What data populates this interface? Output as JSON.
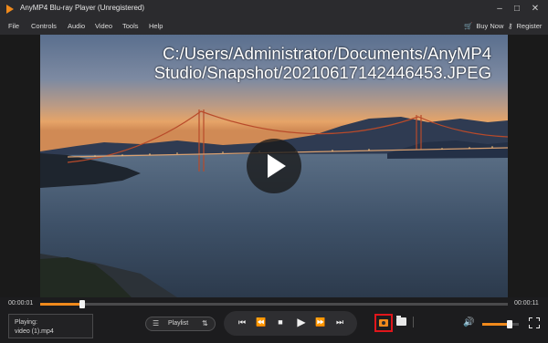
{
  "titlebar": {
    "title": "AnyMP4 Blu-ray Player (Unregistered)",
    "icons": [
      "app-logo-icon",
      "minimize-icon",
      "maximize-icon",
      "close-icon"
    ]
  },
  "menu": {
    "items": [
      "File",
      "Controls",
      "Audio",
      "Video",
      "Tools",
      "Help"
    ],
    "buy_now": "Buy Now",
    "register": "Register"
  },
  "video": {
    "snapshot_path": "C:/Users/Administrator/Documents/AnyMP4 Studio/Snapshot/20210617142446453.JPEG",
    "snapshot_line1": "C:/Users/Administrator/Documents/AnyMP4",
    "snapshot_line2": "Studio/Snapshot/20210617142446453.JPEG"
  },
  "timeline": {
    "current": "00:00:01",
    "total": "00:00:11",
    "progress": 0.09
  },
  "nowplaying": {
    "label": "Playing:",
    "file": "video (1).mp4"
  },
  "playlist": {
    "label": "Playlist"
  },
  "volume": {
    "level": 0.75
  },
  "colors": {
    "accent": "#f08a1c",
    "highlight": "#e0161b",
    "background": "#1c1c1e"
  }
}
